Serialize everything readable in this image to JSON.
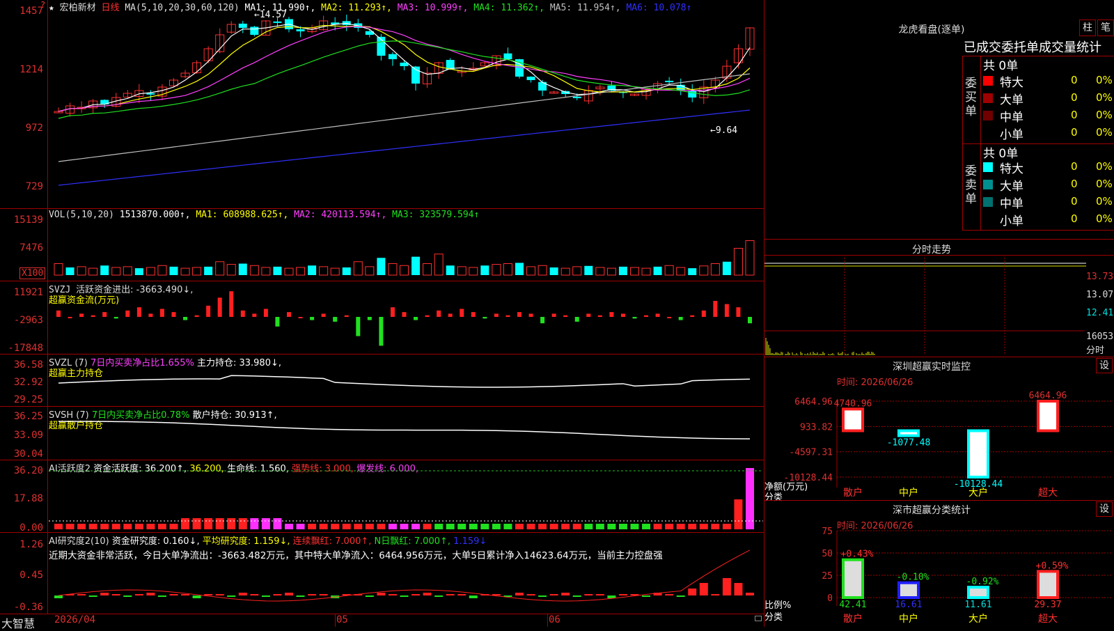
{
  "stock": {
    "name": "宏柏新材",
    "period": "日线",
    "star": "★",
    "mark": "?"
  },
  "main_panel": {
    "ma_label": "MA(5,10,20,30,60,120)",
    "ma1": "MA1: 11.990↑,",
    "ma2": "MA2: 11.293↑,",
    "ma3": "MA3: 10.999↑,",
    "ma4": "MA4: 11.362↑,",
    "ma5": "MA5: 11.954↑,",
    "ma6": "MA6: 10.078↑",
    "high_label": "←14.57",
    "low_label": "←9.64",
    "y_ticks": [
      "1457",
      "1214",
      "972",
      "729"
    ]
  },
  "vol_panel": {
    "title": "VOL(5,10,20)",
    "value": "1513870.000↑,",
    "ma1": "MA1: 608988.625↑,",
    "ma2": "MA2: 420113.594↑,",
    "ma3": "MA3: 323579.594↑",
    "y_ticks": [
      "15139",
      "7476"
    ],
    "unit": "X100"
  },
  "svzj_panel": {
    "title": "SVZJ",
    "desc": "活跃资金进出: -3663.490↓,",
    "sub": "超赢资金流(万元)",
    "y_ticks": [
      "11921",
      "-2963",
      "-17848"
    ]
  },
  "svzl_panel": {
    "title": "SVZL (7)",
    "desc_green": "7日内买卖净占比1.655%",
    "desc2": "主力持仓: 33.980↓,",
    "sub": "超赢主力持仓",
    "y_ticks": [
      "36.58",
      "32.92",
      "29.25"
    ]
  },
  "svsh_panel": {
    "title": "SVSH (7)",
    "desc_green": "7日内买卖净占比0.78%",
    "desc2": "散户持仓: 30.913↑,",
    "sub": "超赢散户持仓",
    "y_ticks": [
      "36.25",
      "33.09",
      "30.04"
    ]
  },
  "ai1_panel": {
    "title": "AI活跃度2",
    "v1": "资金活跃度: 36.200↑,",
    "v2": "36.200,",
    "v3": "生命线: 1.560,",
    "v4": "强势线: 3.000,",
    "v5": "爆发线: 6.000,",
    "y_ticks": [
      "36.20",
      "17.88",
      "0.00"
    ]
  },
  "ai2_panel": {
    "title": "AI研究度2(10)",
    "v1": "资金研究度: 0.160↓,",
    "v2": "平均研究度: 1.159↓,",
    "v3": "连续飘红: 7.000↑,",
    "v4": "N日飘红: 7.000↑,",
    "v5": "1.159↓",
    "comment": "近期大资金非常活跃，今日大单净流出：-3663.482万元，其中特大单净流入：6464.956万元，大单5日累计净入14623.64万元，当前主力控盘强",
    "y_ticks": [
      "1.26",
      "0.45",
      "-0.36"
    ]
  },
  "x_axis": {
    "app": "大智慧",
    "date_start": "2026/04",
    "m1": "05",
    "m2": "06"
  },
  "longhu": {
    "title": "龙虎看盘(逐单)",
    "btn1": "柱",
    "btn2": "笔",
    "header": "已成交委托单成交量统计",
    "buy_label": "委买单",
    "sell_label": "委卖单",
    "buy_total": "共 0单",
    "sell_total": "共 0单",
    "buy_rows": [
      {
        "name": "特大",
        "val": "0",
        "pct": "0%",
        "color": "#ff0000"
      },
      {
        "name": "大单",
        "val": "0",
        "pct": "0%",
        "color": "#a00000"
      },
      {
        "name": "中单",
        "val": "0",
        "pct": "0%",
        "color": "#700000"
      },
      {
        "name": "小单",
        "val": "0",
        "pct": "0%",
        "color": "#000000"
      }
    ],
    "sell_rows": [
      {
        "name": "特大",
        "val": "0",
        "pct": "0%",
        "color": "#00ffff"
      },
      {
        "name": "大单",
        "val": "0",
        "pct": "0%",
        "color": "#009090"
      },
      {
        "name": "中单",
        "val": "0",
        "pct": "0%",
        "color": "#007070"
      },
      {
        "name": "小单",
        "val": "0",
        "pct": "0%",
        "color": "#000000"
      }
    ]
  },
  "intraday": {
    "title": "分时走势",
    "p1": "13.73",
    "p2": "13.07",
    "p3": "12.41",
    "vol": "16053",
    "unit": "分时"
  },
  "sz_monitor": {
    "title": "深圳超赢实时监控",
    "btn": "设",
    "time": "时间: 2026/06/26",
    "y_ticks": [
      "6464.96",
      "933.82",
      "-4597.31",
      "-10128.44"
    ],
    "y_unit": "净额(万元)",
    "x_unit": "分类",
    "categories": [
      "散户",
      "中户",
      "大户",
      "超大"
    ],
    "values": [
      4740.96,
      -1077.48,
      -10128.44,
      6464.96
    ],
    "labels": [
      "4740.96",
      "-1077.48",
      "-10128.44",
      "6464.96"
    ]
  },
  "sz_class": {
    "title": "深市超赢分类统计",
    "btn": "设",
    "time": "时间: 2026/06/26",
    "y_ticks": [
      "75",
      "50",
      "25",
      "0"
    ],
    "y_unit": "比例%",
    "x_unit": "分类",
    "categories": [
      "散户",
      "中户",
      "大户",
      "超大"
    ],
    "values": [
      42.41,
      16.61,
      11.61,
      29.37
    ],
    "changes": [
      "+0.43%",
      "-0.10%",
      "-0.92%",
      "+0.59%"
    ],
    "labels": [
      "42.41",
      "16.61",
      "11.61",
      "29.37"
    ]
  }
}
